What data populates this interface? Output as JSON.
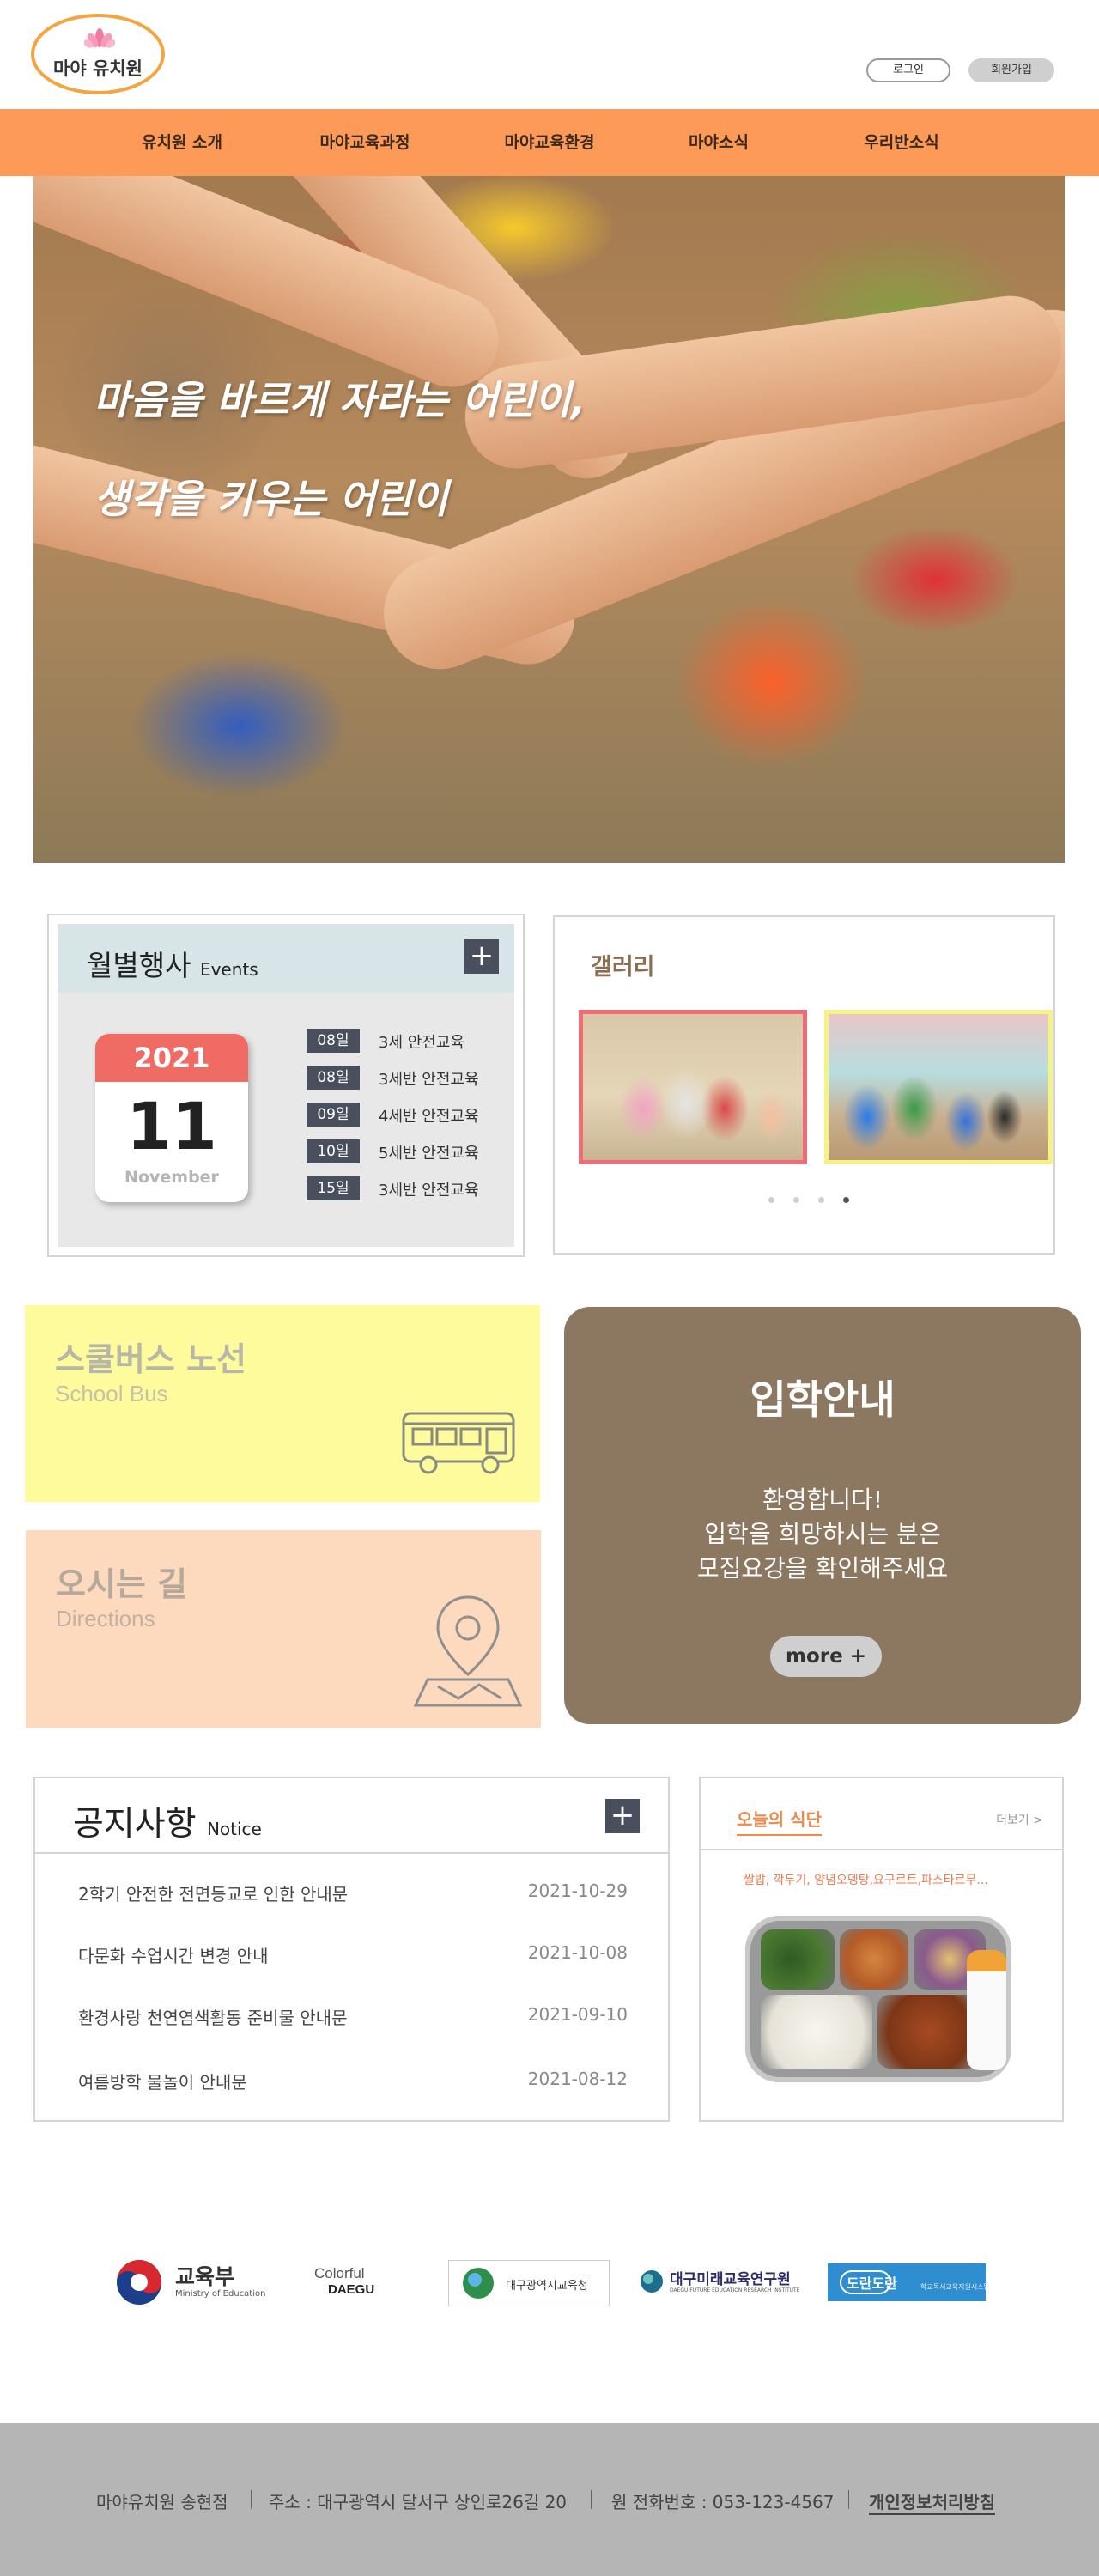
{
  "header": {
    "logo_text": "마야 유치원",
    "login_label": "로그인",
    "join_label": "회원가입"
  },
  "nav": {
    "items": [
      {
        "label": "유치원 소개"
      },
      {
        "label": "마야교육과정"
      },
      {
        "label": "마야교육환경"
      },
      {
        "label": "마야소식"
      },
      {
        "label": "우리반소식"
      }
    ]
  },
  "hero": {
    "line1": "마음을 바르게 자라는 어린이,",
    "line2": "생각을 키우는 어린이"
  },
  "events": {
    "title": "월별행사",
    "title_en": "Events",
    "plus": "+",
    "calendar": {
      "year": "2021",
      "day": "11",
      "month": "November"
    },
    "items": [
      {
        "date": "08일",
        "text": "3세 안전교육"
      },
      {
        "date": "08일",
        "text": "3세반 안전교육"
      },
      {
        "date": "09일",
        "text": "4세반 안전교육"
      },
      {
        "date": "10일",
        "text": "5세반 안전교육"
      },
      {
        "date": "15일",
        "text": "3세반 안전교육"
      }
    ]
  },
  "gallery": {
    "title": "갤러리",
    "slide_count": 4,
    "active_slide": 4
  },
  "bus": {
    "title": "스쿨버스 노선",
    "subtitle": "School Bus",
    "icon": "bus-icon"
  },
  "directions": {
    "title": "오시는 길",
    "subtitle": "Directions",
    "icon": "map-pin-icon"
  },
  "admission": {
    "title": "입학안내",
    "line1": "환영합니다!",
    "line2": "입학을 희망하시는 분은",
    "line3": "모집요강을 확인해주세요",
    "more": "more +"
  },
  "notice": {
    "title": "공지사항",
    "title_en": "Notice",
    "plus": "+",
    "items": [
      {
        "text": "2학기 안전한 전면등교로 인한 안내문",
        "date": "2021-10-29"
      },
      {
        "text": "다문화 수업시간 변경 안내",
        "date": "2021-10-08"
      },
      {
        "text": "환경사랑 천연염색활동 준비물 안내문",
        "date": "2021-09-10"
      },
      {
        "text": "여름방학 물놀이 안내문",
        "date": "2021-08-12"
      }
    ]
  },
  "meal": {
    "title": "오늘의 식단",
    "more": "더보기 >",
    "menu": "쌀밥, 깍두기, 양념오뎅탕,요구르트,파스타르무..."
  },
  "partners": {
    "moe_name": "교육부",
    "moe_en": "Ministry of Education",
    "daegu_line1": "Colorful",
    "daegu_line2": "DAEGU",
    "dge": "대구광역시교육청",
    "dfe": "대구미래교육연구원",
    "dfe_en": "DAEGU FUTURE EDUCATION RESEARCH INSTITUTE",
    "library": "도란도란",
    "library_sub": "학교독서교육지원시스템"
  },
  "footer": {
    "name": "마야유치원 송현점",
    "address": "주소 : 대구광역시 달서구 상인로26길 20",
    "phone": "원 전화번호 : 053-123-4567",
    "policy": "개인정보처리방침"
  },
  "colors": {
    "nav": "#fd9a58",
    "admission": "#8c7861",
    "bus_bg": "#fdfb9c",
    "directions_bg": "#fdd9bd",
    "calendar_red": "#f06b64",
    "footer": "#b5b5b5"
  }
}
